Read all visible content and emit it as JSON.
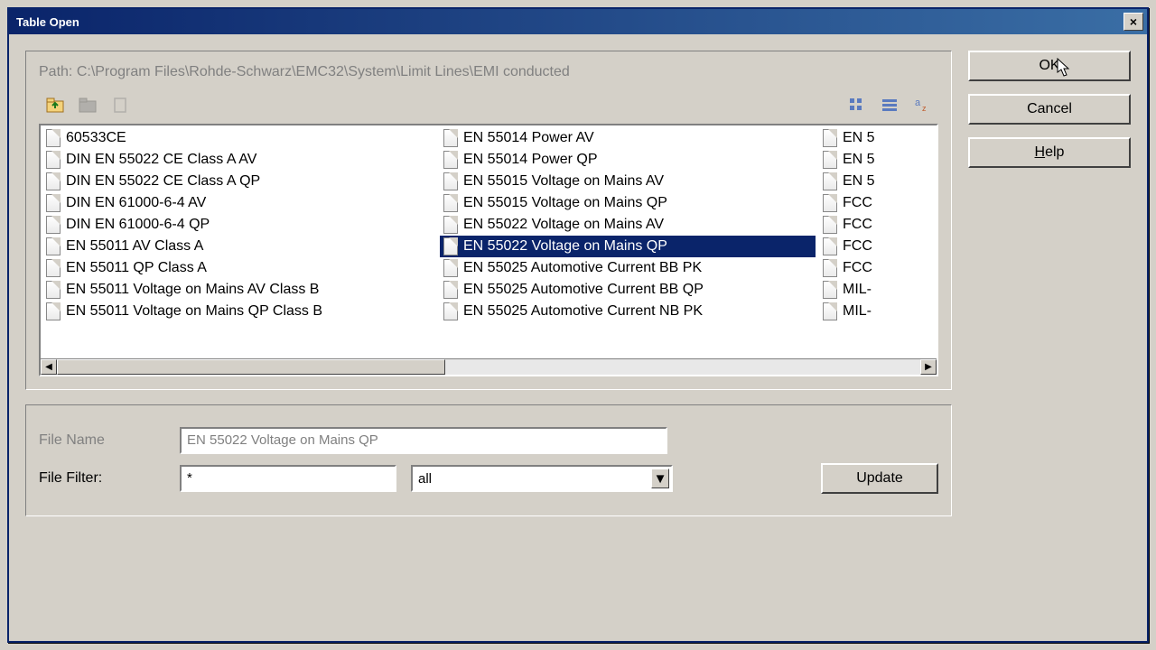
{
  "title": "Table Open",
  "path_prefix": "Path:",
  "path": "C:\\Program Files\\Rohde-Schwarz\\EMC32\\System\\Limit Lines\\EMI conducted",
  "columns": [
    [
      "60533CE",
      "DIN EN 55022 CE Class A AV",
      "DIN EN 55022 CE Class A QP",
      "DIN EN 61000-6-4 AV",
      "DIN EN 61000-6-4 QP",
      "EN 55011 AV Class A",
      "EN 55011 QP Class A",
      "EN 55011 Voltage on Mains AV Class B",
      "EN 55011 Voltage on Mains QP Class B"
    ],
    [
      "EN 55014 Power AV",
      "EN 55014 Power QP",
      "EN 55015 Voltage on Mains AV",
      "EN 55015 Voltage on Mains QP",
      "EN 55022 Voltage on Mains AV",
      "EN 55022 Voltage on Mains QP",
      "EN 55025 Automotive Current BB PK",
      "EN 55025 Automotive Current BB QP",
      "EN 55025 Automotive Current NB PK"
    ],
    [
      "EN 5",
      "EN 5",
      "EN 5",
      "FCC",
      "FCC",
      "FCC",
      "FCC",
      "MIL-",
      "MIL-"
    ]
  ],
  "selected_index": {
    "col": 1,
    "row": 5
  },
  "file_name_label": "File Name",
  "file_name_value": "EN 55022 Voltage on Mains QP",
  "file_filter_label": "File Filter:",
  "file_filter_pattern": "*",
  "file_filter_type": "all",
  "buttons": {
    "ok": "OK",
    "cancel": "Cancel",
    "help": "Help",
    "update": "Update"
  }
}
